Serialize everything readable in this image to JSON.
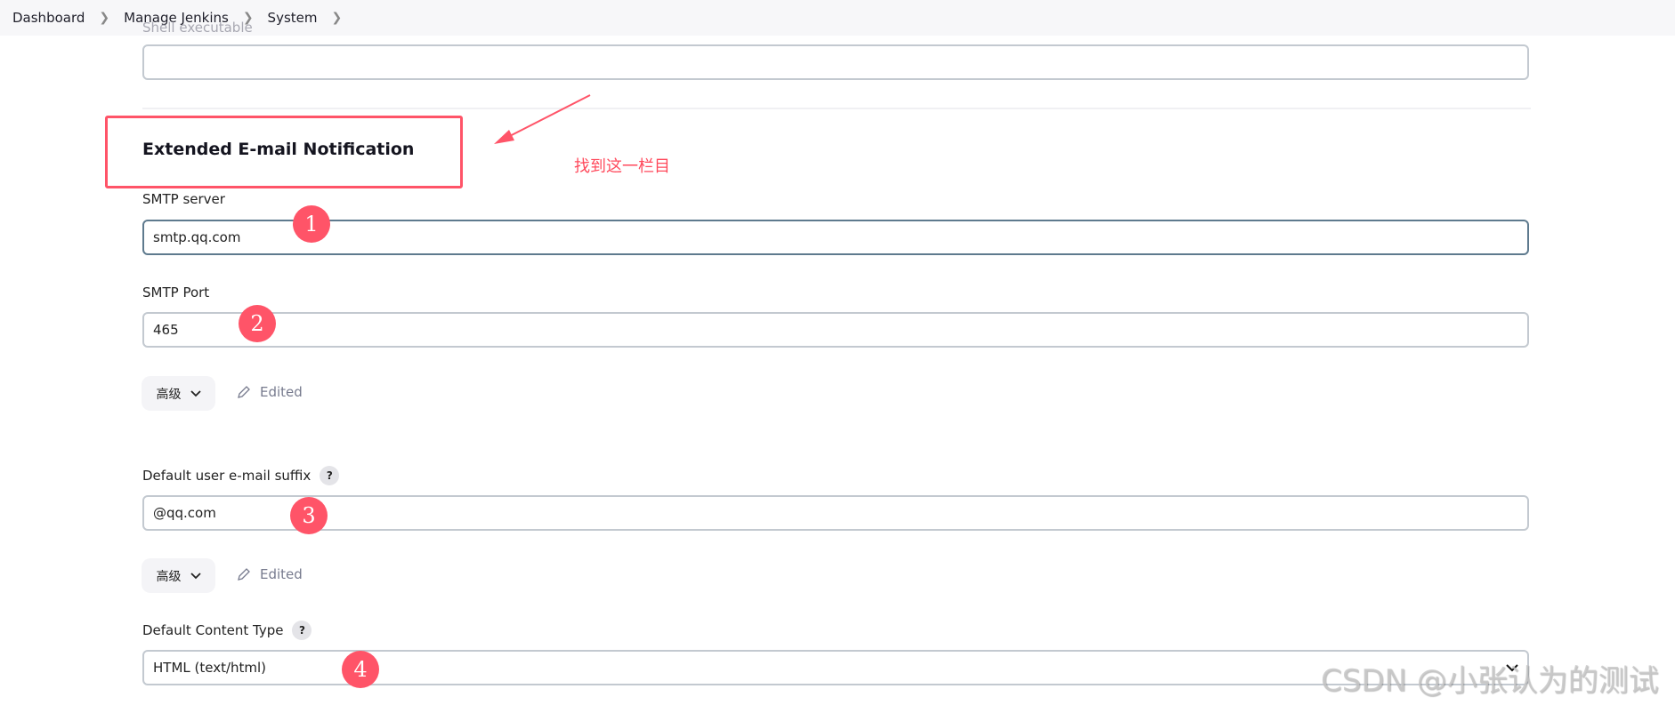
{
  "breadcrumb": [
    "Dashboard",
    "Manage Jenkins",
    "System"
  ],
  "previous_field": {
    "label": "Shell executable",
    "value": ""
  },
  "section": {
    "title": "Extended E-mail Notification"
  },
  "annotation": {
    "note": "找到这一栏目",
    "color": "#ff5468",
    "markers": [
      "1",
      "2",
      "3",
      "4"
    ]
  },
  "fields": {
    "smtp_server": {
      "label": "SMTP server",
      "value": "smtp.qq.com"
    },
    "smtp_port": {
      "label": "SMTP Port",
      "value": "465"
    },
    "advanced_1": {
      "label": "高级",
      "status": "Edited"
    },
    "email_suffix": {
      "label": "Default user e-mail suffix",
      "help": "?",
      "value": "@qq.com"
    },
    "advanced_2": {
      "label": "高级",
      "status": "Edited"
    },
    "content_type": {
      "label": "Default Content Type",
      "help": "?",
      "value": "HTML (text/html)"
    }
  },
  "watermark": "CSDN @小张认为的测试"
}
